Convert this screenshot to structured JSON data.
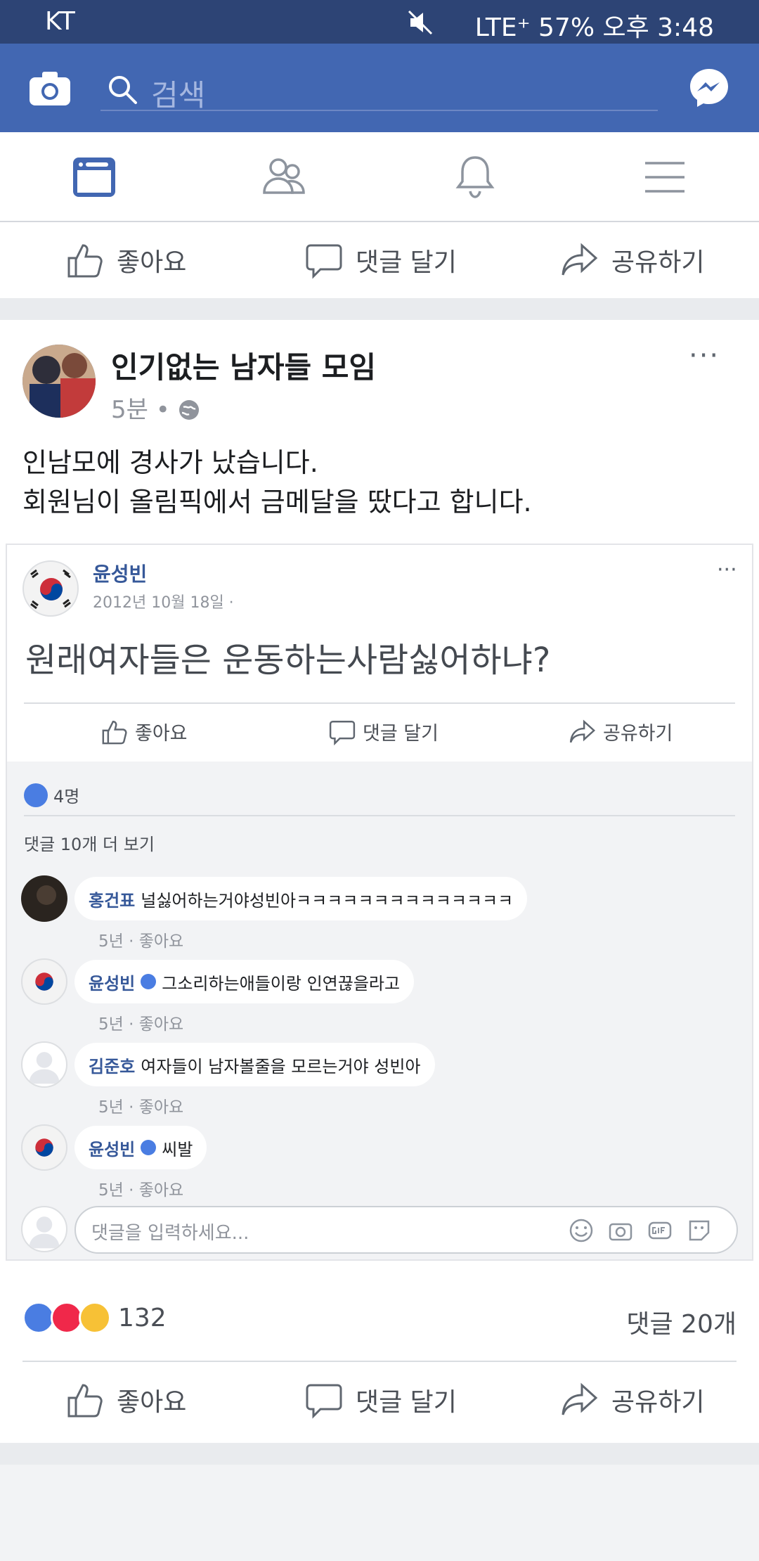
{
  "status_bar": {
    "carrier": "KT",
    "right": "LTE⁺ 57% 오후 3:48"
  },
  "topbar": {
    "search_placeholder": "검색"
  },
  "nav_tabs": [
    "news-feed",
    "friends",
    "notifications",
    "menu"
  ],
  "top_actions": {
    "like": "좋아요",
    "comment": "댓글 달기",
    "share": "공유하기"
  },
  "post": {
    "group_name": "인기없는 남자들 모임",
    "time": "5분 • ",
    "more": "···",
    "text_line1": "인남모에 경사가 났습니다.",
    "text_line2": "회원님이 올림픽에서 금메달을 땄다고 합니다.",
    "avatar_caption": "인기없는 남자들 모임",
    "embedded": {
      "author": "윤성빈",
      "date": "2012년 10월 18일 · ",
      "more": "···",
      "text": "원래여자들은 운동하는사람싫어하냐?",
      "like": "좋아요",
      "comment": "댓글 달기",
      "share": "공유하기",
      "like_count": "4명",
      "more_comments": "댓글 10개 더 보기",
      "comments": [
        {
          "name": "홍건표",
          "text": "널싫어하는거야성빈아ㅋㅋㅋㅋㅋㅋㅋㅋㅋㅋㅋㅋㅋㅋ",
          "meta": "5년 · 좋아요"
        },
        {
          "name": "윤성빈",
          "text": "그소리하는애들이랑 인연끊을라고",
          "meta": "5년 · 좋아요"
        },
        {
          "name": "김준호",
          "text": "여자들이 남자볼줄을 모르는거야 성빈아",
          "meta": "5년 · 좋아요"
        },
        {
          "name": "윤성빈",
          "text": "씨발",
          "meta": "5년 · 좋아요"
        }
      ],
      "input_placeholder": "댓글을 입력하세요..."
    },
    "reaction_count": "132",
    "comment_count": "댓글 20개",
    "like": "좋아요",
    "comment": "댓글 달기",
    "share": "공유하기"
  },
  "colors": {
    "brand": "#4267b2",
    "status_bar": "#2d4475",
    "link": "#365899",
    "like_blue": "#4a7de2",
    "love_red": "#f0284a",
    "sad_yellow": "#f7c136"
  }
}
